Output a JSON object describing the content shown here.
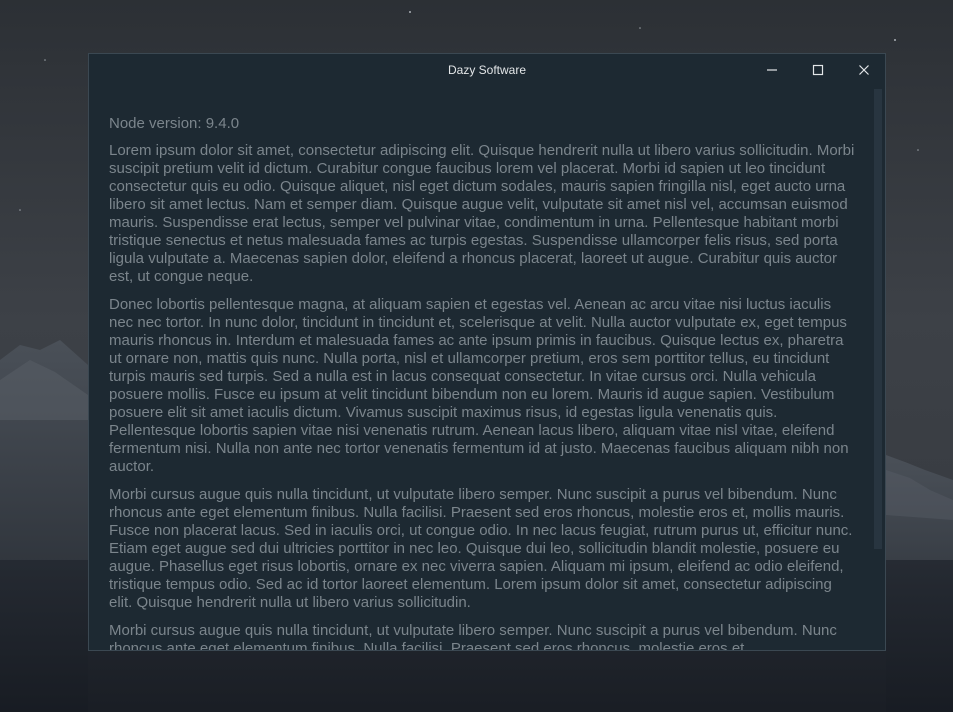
{
  "window": {
    "title": "Dazy Software"
  },
  "controls": {
    "minimize_icon": "minimize-icon",
    "maximize_icon": "maximize-icon",
    "close_icon": "close-icon"
  },
  "content": {
    "node_version": "Node version: 9.4.0",
    "paragraphs": [
      "Lorem ipsum dolor sit amet, consectetur adipiscing elit. Quisque hendrerit nulla ut libero varius sollicitudin. Morbi suscipit pretium velit id dictum. Curabitur congue faucibus lorem vel placerat. Morbi id sapien ut leo tincidunt consectetur quis eu odio. Quisque aliquet, nisl eget dictum sodales, mauris sapien fringilla nisl, eget aucto urna libero sit amet lectus. Nam et semper diam. Quisque augue velit, vulputate sit amet nisl vel, accumsan euismod mauris. Suspendisse erat lectus, semper vel pulvinar vitae, condimentum in urna. Pellentesque habitant morbi tristique senectus et netus malesuada fames ac turpis egestas. Suspendisse ullamcorper felis risus, sed porta ligula vulputate a. Maecenas sapien dolor, eleifend a rhoncus placerat, laoreet ut augue. Curabitur quis auctor est, ut congue neque.",
      "Donec lobortis pellentesque magna, at aliquam sapien et egestas vel. Aenean ac arcu vitae nisi luctus iaculis nec nec tortor. In nunc dolor, tincidunt in tincidunt et, scelerisque at velit. Nulla auctor vulputate ex, eget tempus mauris rhoncus in. Interdum et malesuada fames ac ante ipsum primis in faucibus. Quisque lectus ex, pharetra ut ornare non, mattis quis nunc. Nulla porta, nisl et ullamcorper pretium, eros sem porttitor tellus, eu tincidunt turpis mauris sed turpis. Sed a nulla est in lacus consequat consectetur. In vitae cursus orci. Nulla vehicula posuere mollis. Fusce eu ipsum at velit tincidunt bibendum non eu lorem. Mauris id augue sapien. Vestibulum posuere elit sit amet iaculis dictum. Vivamus suscipit maximus risus, id egestas ligula venenatis quis. Pellentesque lobortis sapien vitae nisi venenatis rutrum. Aenean lacus libero, aliquam vitae nisl vitae, eleifend fermentum nisi. Nulla non ante nec tortor venenatis fermentum id at justo. Maecenas faucibus aliquam nibh non auctor.",
      "Morbi cursus augue quis nulla tincidunt, ut vulputate libero semper. Nunc suscipit a purus vel bibendum. Nunc rhoncus ante eget elementum finibus. Nulla facilisi. Praesent sed eros rhoncus, molestie eros et, mollis mauris. Fusce non placerat lacus. Sed in iaculis orci, ut congue odio. In nec lacus feugiat, rutrum purus ut, efficitur nunc. Etiam eget augue sed dui ultricies porttitor in nec leo. Quisque dui leo, sollicitudin blandit molestie, posuere eu augue. Phasellus eget risus lobortis, ornare ex nec viverra sapien. Aliquam mi ipsum, eleifend ac odio eleifend, tristique tempus odio. Sed ac id tortor laoreet elementum. Lorem ipsum dolor sit amet, consectetur adipiscing elit. Quisque hendrerit nulla ut libero varius sollicitudin.",
      "Morbi cursus augue quis nulla tincidunt, ut vulputate libero semper. Nunc suscipit a purus vel bibendum. Nunc rhoncus ante eget elementum finibus. Nulla facilisi. Praesent sed eros rhoncus, molestie eros et,"
    ]
  },
  "colors": {
    "window_bg": "#1d2932",
    "text": "#7b858c",
    "title_text": "#e3e6e8"
  }
}
